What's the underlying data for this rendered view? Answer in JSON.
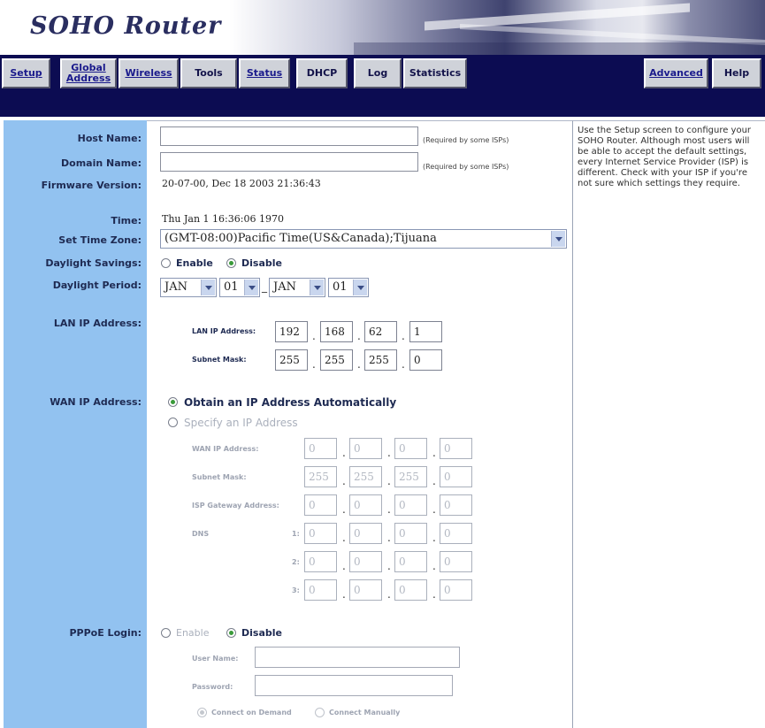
{
  "brand": {
    "title": "SOHO Router"
  },
  "nav": {
    "setup": "Setup",
    "global_address": "Global\nAddress",
    "wireless": "Wireless",
    "tools": "Tools",
    "status": "Status",
    "dhcp": "DHCP",
    "log": "Log",
    "statistics": "Statistics",
    "advanced": "Advanced",
    "help": "Help"
  },
  "labels": {
    "host_name": "Host Name:",
    "domain_name": "Domain Name:",
    "firmware_version": "Firmware Version:",
    "time": "Time:",
    "set_time_zone": "Set Time Zone:",
    "daylight_savings": "Daylight Savings:",
    "daylight_period": "Daylight Period:",
    "lan_ip_address": "LAN IP Address:",
    "wan_ip_address": "WAN IP Address:",
    "pppoe_login": "PPPoE Login:"
  },
  "fields": {
    "host_name": "",
    "domain_name": "",
    "required_note": "(Required by some ISPs)",
    "firmware_version": "20-07-00, Dec 18 2003 21:36:43",
    "time": "Thu Jan 1 16:36:06 1970",
    "time_zone": "(GMT-08:00)Pacific Time(US&Canada);Tijuana",
    "daylight_enable": "Enable",
    "daylight_disable": "Disable",
    "period": {
      "start_month": "JAN",
      "start_day": "01",
      "sep": "_",
      "end_month": "JAN",
      "end_day": "01"
    }
  },
  "lan": {
    "ip_label": "LAN IP Address:",
    "mask_label": "Subnet Mask:",
    "ip": [
      "192",
      "168",
      "62",
      "1"
    ],
    "mask": [
      "255",
      "255",
      "255",
      "0"
    ]
  },
  "wan": {
    "obtain_auto": "Obtain an IP Address Automatically",
    "specify": "Specify an IP Address",
    "ip_label": "WAN IP Address:",
    "mask_label": "Subnet Mask:",
    "gateway_label": "ISP Gateway Address:",
    "dns_label": "DNS",
    "dns1_label": "1:",
    "dns2_label": "2:",
    "dns3_label": "3:",
    "ip": [
      "0",
      "0",
      "0",
      "0"
    ],
    "mask": [
      "255",
      "255",
      "255",
      "0"
    ],
    "gateway": [
      "0",
      "0",
      "0",
      "0"
    ],
    "dns1": [
      "0",
      "0",
      "0",
      "0"
    ],
    "dns2": [
      "0",
      "0",
      "0",
      "0"
    ],
    "dns3": [
      "0",
      "0",
      "0",
      "0"
    ]
  },
  "pppoe": {
    "enable": "Enable",
    "disable": "Disable",
    "user_name_label": "User Name:",
    "password_label": "Password:",
    "user_name": "",
    "password": "",
    "connect_on_demand": "Connect on Demand",
    "connect_manually": "Connect Manually"
  },
  "help": {
    "text": "Use the Setup screen to configure your SOHO Router. Although most users will be able to accept the default settings, every Internet Service Provider (ISP) is different. Check with your ISP if you're not sure which settings they require."
  }
}
